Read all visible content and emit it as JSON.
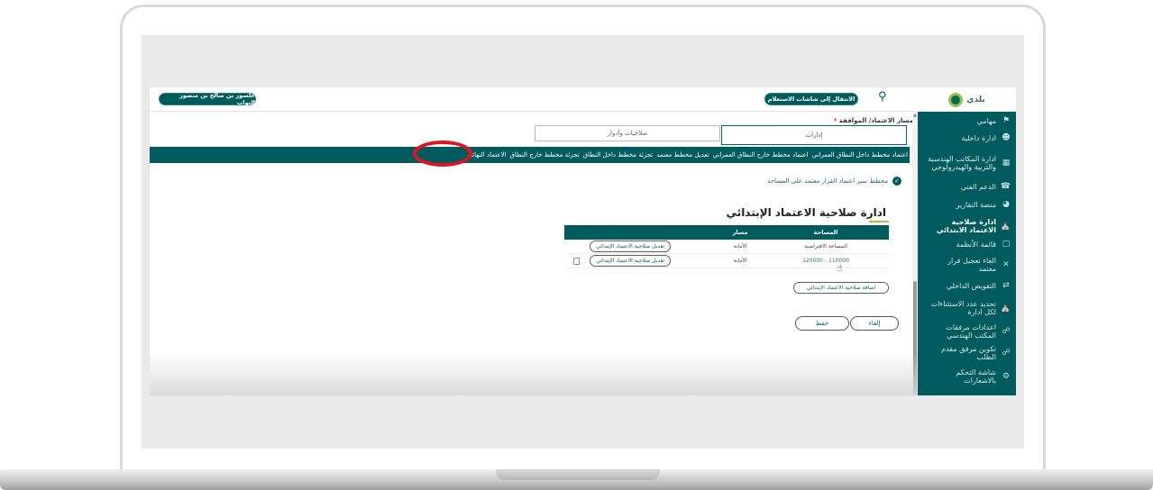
{
  "header": {
    "user_name": "علسور بن صالح بن منصور الثواب",
    "switch_button": "الانتقال إلى شاشات الاستعلام",
    "brand_text": "بلدي"
  },
  "sidebar": {
    "items": [
      {
        "label": "مهامي",
        "icon": "flag-icon"
      },
      {
        "label": "ادارة داخلية",
        "icon": "users-icon"
      },
      {
        "label": "ادارة المكاتب الهندسية والتربية والهيدرولوجي",
        "icon": "building-icon"
      },
      {
        "label": "الدعم الفني",
        "icon": "headset-icon"
      },
      {
        "label": "منصة التقارير",
        "icon": "chart-icon"
      },
      {
        "label": "ادارة صلاحية الاعتماد الابتدائي",
        "icon": "bank-icon",
        "active": true
      },
      {
        "label": "قائمة الأنظمة",
        "icon": "document-icon"
      },
      {
        "label": "الغاء تعجيل قرار معتمد",
        "icon": "close-icon"
      },
      {
        "label": "التفويض الداخلي",
        "icon": "swap-icon"
      },
      {
        "label": "تحديد عدد الاستثناءات لكل ادارة",
        "icon": "bank-icon"
      },
      {
        "label": "اعدادات مرفقات المكتب الهندسي",
        "icon": "link-icon"
      },
      {
        "label": "تكوين مرفق مقدم الطلب",
        "icon": "link-icon"
      },
      {
        "label": "شاشة التحكم بالاشعارات",
        "icon": "settings-icon"
      }
    ]
  },
  "breadcrumb": {
    "label": "مسار الاعتماد/ الموافقة",
    "required_mark": "*"
  },
  "tabs": [
    {
      "label": "إدارات",
      "selected": true
    },
    {
      "label": "صلاحيات وأدوار",
      "selected": false
    }
  ],
  "steps": [
    "اعتماد مخطط داخل النطاق العمراني",
    "اعتماد مخطط خارج النطاق العمراني",
    "تعديل مخطط معتمد",
    "تجزئة مخطط داخل النطاق",
    "تجزئة مخطط خارج النطاق",
    "الاعتماد النهائي"
  ],
  "note": "مخطط سير اعتماد القرار معتمد على المساحة",
  "section_title": "ادارة صلاحية الاعتماد الإبتدائي",
  "grid": {
    "headers": {
      "area": "المساحة",
      "path": "مسار"
    },
    "rows": [
      {
        "area": "المساحة الافتراضية",
        "path": "الأمانة",
        "action": "تعديل صلاحية الاعتماد الإبتدائي"
      },
      {
        "area": "110000 - 120000",
        "path": "الأمانة",
        "action": "تعديل صلاحية الاعتماد الإبتدائي"
      }
    ]
  },
  "add_button": "اضافة صلاحية الاعتماد الإبتدائي",
  "cancel_button": "إلغاء",
  "save_button": "حفظ",
  "colors": {
    "primary": "#005b5e",
    "highlight": "#e0131f",
    "accent": "#a1c43b"
  }
}
